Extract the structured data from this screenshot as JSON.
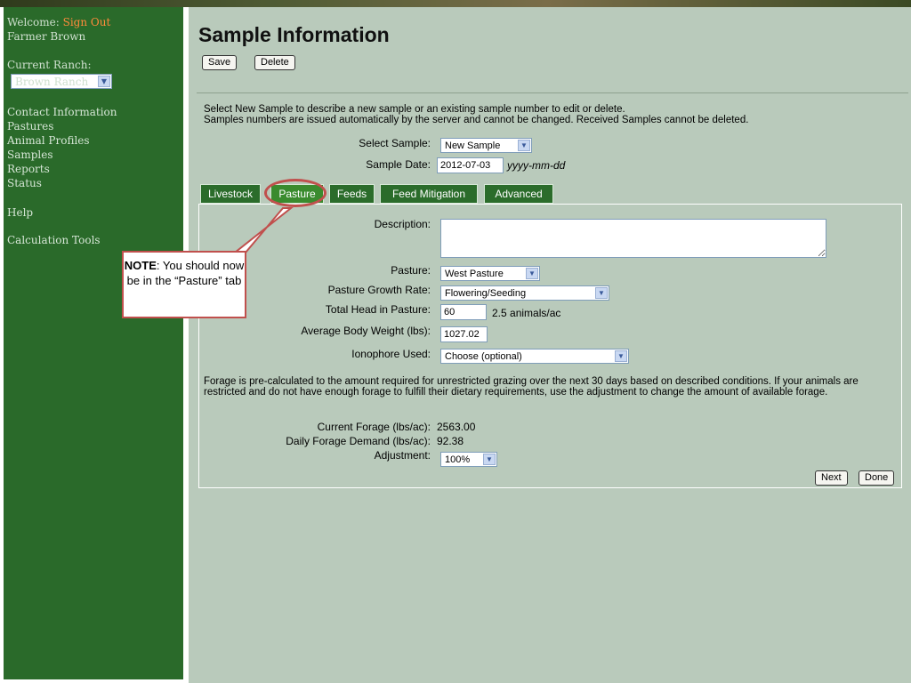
{
  "sidebar": {
    "welcome": "Welcome:",
    "sign_out": "Sign Out",
    "user_name": "Farmer Brown",
    "current_ranch_label": "Current Ranch:",
    "current_ranch_value": "Brown Ranch",
    "nav": [
      "Contact Information",
      "Pastures",
      "Animal Profiles",
      "Samples",
      "Reports",
      "Status"
    ],
    "help": "Help",
    "tools": "Calculation Tools"
  },
  "page": {
    "title": "Sample Information",
    "save_label": "Save",
    "delete_label": "Delete",
    "intro_1": "Select New Sample to describe a new sample or an existing sample number to edit or delete.",
    "intro_2": "Samples numbers are issued automatically by the server and cannot be changed. Received Samples cannot be deleted.",
    "select_sample_label": "Select Sample:",
    "select_sample_value": "New Sample",
    "sample_date_label": "Sample Date:",
    "sample_date_value": "2012-07-03",
    "date_format": "yyyy-mm-dd"
  },
  "tabs": [
    "Livestock",
    "Pasture",
    "Feeds",
    "Feed Mitigation",
    "Advanced"
  ],
  "pasture_form": {
    "description_label": "Description:",
    "pasture_label": "Pasture:",
    "pasture_value": "West Pasture",
    "growth_label": "Pasture Growth Rate:",
    "growth_value": "Flowering/Seeding",
    "head_label": "Total Head in Pasture:",
    "head_value": "60",
    "density": "2.5 animals/ac",
    "weight_label": "Average Body Weight (lbs):",
    "weight_value": "1027.02",
    "ionophore_label": "Ionophore Used:",
    "ionophore_value": "Choose (optional)",
    "forage_text": "Forage is pre-calculated to the amount required for unrestricted grazing over the next 30 days based on described conditions. If your animals are restricted and do not have enough forage to fulfill their dietary requirements, use the adjustment to change the amount of available forage.",
    "current_forage_label": "Current Forage (lbs/ac):",
    "current_forage_value": "2563.00",
    "daily_demand_label": "Daily Forage Demand (lbs/ac):",
    "daily_demand_value": "92.38",
    "adjustment_label": "Adjustment:",
    "adjustment_value": "100%",
    "next_label": "Next",
    "done_label": "Done"
  },
  "annotation": {
    "note_bold": "NOTE",
    "note_text": ": You should now be in the “Pasture” tab",
    "color": "#c0504d"
  }
}
